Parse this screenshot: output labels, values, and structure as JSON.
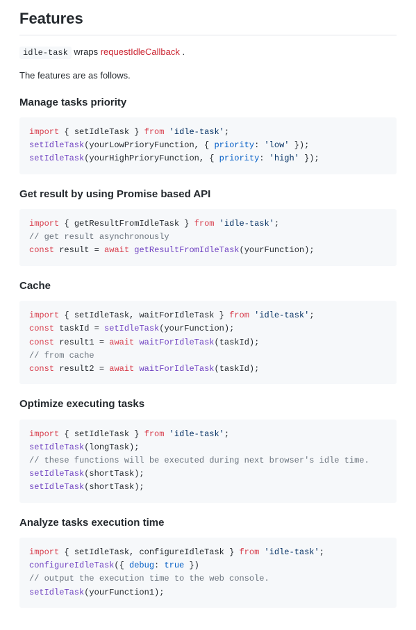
{
  "title": "Features",
  "intro": {
    "code": "idle-task",
    "mid": " wraps ",
    "link": "requestIdleCallback",
    "tail": " ."
  },
  "desc": "The features are as follows.",
  "sections": [
    {
      "heading": "Manage tasks priority",
      "code": [
        [
          {
            "c": "t-kw",
            "t": "import"
          },
          {
            "c": "t-pn",
            "t": " { "
          },
          {
            "c": "t-id",
            "t": "setIdleTask"
          },
          {
            "c": "t-pn",
            "t": " } "
          },
          {
            "c": "t-kw",
            "t": "from"
          },
          {
            "c": "t-pn",
            "t": " "
          },
          {
            "c": "t-str",
            "t": "'idle-task'"
          },
          {
            "c": "t-pn",
            "t": ";"
          }
        ],
        [
          {
            "c": "t-fn",
            "t": "setIdleTask"
          },
          {
            "c": "t-pn",
            "t": "("
          },
          {
            "c": "t-id",
            "t": "yourLowPrioryFunction"
          },
          {
            "c": "t-pn",
            "t": ", { "
          },
          {
            "c": "t-attr",
            "t": "priority"
          },
          {
            "c": "t-pn",
            "t": ": "
          },
          {
            "c": "t-str",
            "t": "'low'"
          },
          {
            "c": "t-pn",
            "t": " });"
          }
        ],
        [
          {
            "c": "t-fn",
            "t": "setIdleTask"
          },
          {
            "c": "t-pn",
            "t": "("
          },
          {
            "c": "t-id",
            "t": "yourHighPrioryFunction"
          },
          {
            "c": "t-pn",
            "t": ", { "
          },
          {
            "c": "t-attr",
            "t": "priority"
          },
          {
            "c": "t-pn",
            "t": ": "
          },
          {
            "c": "t-str",
            "t": "'high'"
          },
          {
            "c": "t-pn",
            "t": " });"
          }
        ]
      ]
    },
    {
      "heading": "Get result by using Promise based API",
      "code": [
        [
          {
            "c": "t-kw",
            "t": "import"
          },
          {
            "c": "t-pn",
            "t": " { "
          },
          {
            "c": "t-id",
            "t": "getResultFromIdleTask"
          },
          {
            "c": "t-pn",
            "t": " } "
          },
          {
            "c": "t-kw",
            "t": "from"
          },
          {
            "c": "t-pn",
            "t": " "
          },
          {
            "c": "t-str",
            "t": "'idle-task'"
          },
          {
            "c": "t-pn",
            "t": ";"
          }
        ],
        [
          {
            "c": "t-cmnt",
            "t": "// get result asynchronously"
          }
        ],
        [
          {
            "c": "t-kw",
            "t": "const"
          },
          {
            "c": "t-pn",
            "t": " "
          },
          {
            "c": "t-id",
            "t": "result"
          },
          {
            "c": "t-pn",
            "t": " = "
          },
          {
            "c": "t-kw",
            "t": "await"
          },
          {
            "c": "t-pn",
            "t": " "
          },
          {
            "c": "t-fn",
            "t": "getResultFromIdleTask"
          },
          {
            "c": "t-pn",
            "t": "("
          },
          {
            "c": "t-id",
            "t": "yourFunction"
          },
          {
            "c": "t-pn",
            "t": ");"
          }
        ]
      ]
    },
    {
      "heading": "Cache",
      "code": [
        [
          {
            "c": "t-kw",
            "t": "import"
          },
          {
            "c": "t-pn",
            "t": " { "
          },
          {
            "c": "t-id",
            "t": "setIdleTask"
          },
          {
            "c": "t-pn",
            "t": ", "
          },
          {
            "c": "t-id",
            "t": "waitForIdleTask"
          },
          {
            "c": "t-pn",
            "t": " } "
          },
          {
            "c": "t-kw",
            "t": "from"
          },
          {
            "c": "t-pn",
            "t": " "
          },
          {
            "c": "t-str",
            "t": "'idle-task'"
          },
          {
            "c": "t-pn",
            "t": ";"
          }
        ],
        [
          {
            "c": "t-kw",
            "t": "const"
          },
          {
            "c": "t-pn",
            "t": " "
          },
          {
            "c": "t-id",
            "t": "taskId"
          },
          {
            "c": "t-pn",
            "t": " = "
          },
          {
            "c": "t-fn",
            "t": "setIdleTask"
          },
          {
            "c": "t-pn",
            "t": "("
          },
          {
            "c": "t-id",
            "t": "yourFunction"
          },
          {
            "c": "t-pn",
            "t": ");"
          }
        ],
        [
          {
            "c": "t-kw",
            "t": "const"
          },
          {
            "c": "t-pn",
            "t": " "
          },
          {
            "c": "t-id",
            "t": "result1"
          },
          {
            "c": "t-pn",
            "t": " = "
          },
          {
            "c": "t-kw",
            "t": "await"
          },
          {
            "c": "t-pn",
            "t": " "
          },
          {
            "c": "t-fn",
            "t": "waitForIdleTask"
          },
          {
            "c": "t-pn",
            "t": "("
          },
          {
            "c": "t-id",
            "t": "taskId"
          },
          {
            "c": "t-pn",
            "t": ");"
          }
        ],
        [
          {
            "c": "t-cmnt",
            "t": "// from cache"
          }
        ],
        [
          {
            "c": "t-kw",
            "t": "const"
          },
          {
            "c": "t-pn",
            "t": " "
          },
          {
            "c": "t-id",
            "t": "result2"
          },
          {
            "c": "t-pn",
            "t": " = "
          },
          {
            "c": "t-kw",
            "t": "await"
          },
          {
            "c": "t-pn",
            "t": " "
          },
          {
            "c": "t-fn",
            "t": "waitForIdleTask"
          },
          {
            "c": "t-pn",
            "t": "("
          },
          {
            "c": "t-id",
            "t": "taskId"
          },
          {
            "c": "t-pn",
            "t": ");"
          }
        ]
      ]
    },
    {
      "heading": "Optimize executing tasks",
      "code": [
        [
          {
            "c": "t-kw",
            "t": "import"
          },
          {
            "c": "t-pn",
            "t": " { "
          },
          {
            "c": "t-id",
            "t": "setIdleTask"
          },
          {
            "c": "t-pn",
            "t": " } "
          },
          {
            "c": "t-kw",
            "t": "from"
          },
          {
            "c": "t-pn",
            "t": " "
          },
          {
            "c": "t-str",
            "t": "'idle-task'"
          },
          {
            "c": "t-pn",
            "t": ";"
          }
        ],
        [
          {
            "c": "t-fn",
            "t": "setIdleTask"
          },
          {
            "c": "t-pn",
            "t": "("
          },
          {
            "c": "t-id",
            "t": "longTask"
          },
          {
            "c": "t-pn",
            "t": ");"
          }
        ],
        [
          {
            "c": "t-cmnt",
            "t": "// these functions will be executed during next browser's idle time."
          }
        ],
        [
          {
            "c": "t-fn",
            "t": "setIdleTask"
          },
          {
            "c": "t-pn",
            "t": "("
          },
          {
            "c": "t-id",
            "t": "shortTask"
          },
          {
            "c": "t-pn",
            "t": ");"
          }
        ],
        [
          {
            "c": "t-fn",
            "t": "setIdleTask"
          },
          {
            "c": "t-pn",
            "t": "("
          },
          {
            "c": "t-id",
            "t": "shortTask"
          },
          {
            "c": "t-pn",
            "t": ");"
          }
        ]
      ]
    },
    {
      "heading": "Analyze tasks execution time",
      "code": [
        [
          {
            "c": "t-kw",
            "t": "import"
          },
          {
            "c": "t-pn",
            "t": " { "
          },
          {
            "c": "t-id",
            "t": "setIdleTask"
          },
          {
            "c": "t-pn",
            "t": ", "
          },
          {
            "c": "t-id",
            "t": "configureIdleTask"
          },
          {
            "c": "t-pn",
            "t": " } "
          },
          {
            "c": "t-kw",
            "t": "from"
          },
          {
            "c": "t-pn",
            "t": " "
          },
          {
            "c": "t-str",
            "t": "'idle-task'"
          },
          {
            "c": "t-pn",
            "t": ";"
          }
        ],
        [
          {
            "c": "t-fn",
            "t": "configureIdleTask"
          },
          {
            "c": "t-pn",
            "t": "({ "
          },
          {
            "c": "t-attr",
            "t": "debug"
          },
          {
            "c": "t-pn",
            "t": ": "
          },
          {
            "c": "t-bool",
            "t": "true"
          },
          {
            "c": "t-pn",
            "t": " })"
          }
        ],
        [
          {
            "c": "t-cmnt",
            "t": "// output the execution time to the web console."
          }
        ],
        [
          {
            "c": "t-fn",
            "t": "setIdleTask"
          },
          {
            "c": "t-pn",
            "t": "("
          },
          {
            "c": "t-id",
            "t": "yourFunction1"
          },
          {
            "c": "t-pn",
            "t": ");"
          }
        ]
      ]
    }
  ]
}
